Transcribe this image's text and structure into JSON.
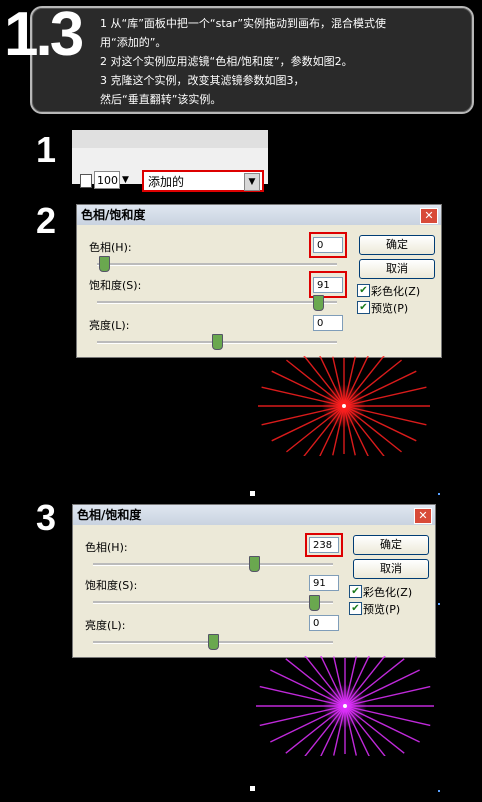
{
  "header": {
    "step": "1.3",
    "lines": [
      "1 从“库”面板中把一个“star”实例拖动到画布，混合模式使",
      "用“添加的”。",
      "2 对这个实例应用滤镜“色相/饱和度”，参数如图2。",
      "3 克隆这个实例，改变其滤镜参数如图3，",
      "然后“垂直翻转”该实例。"
    ]
  },
  "steps": {
    "one": "1",
    "two": "2",
    "three": "3"
  },
  "toolbar": {
    "opacity": "100",
    "blend_mode": "添加的"
  },
  "dialog2": {
    "title": "色相/饱和度",
    "hue_label": "色相(H):",
    "hue_value": "0",
    "sat_label": "饱和度(S):",
    "sat_value": "91",
    "bright_label": "亮度(L):",
    "bright_value": "0",
    "ok": "确定",
    "cancel": "取消",
    "colorize": "彩色化(Z)",
    "preview": "预览(P)"
  },
  "dialog3": {
    "title": "色相/饱和度",
    "hue_label": "色相(H):",
    "hue_value": "238",
    "sat_label": "饱和度(S):",
    "sat_value": "91",
    "bright_label": "亮度(L):",
    "bright_value": "0",
    "ok": "确定",
    "cancel": "取消",
    "colorize": "彩色化(Z)",
    "preview": "预览(P)"
  },
  "colors": {
    "star_red": "#ff2020",
    "star_magenta": "#e030ff",
    "highlight": "#dd0000"
  },
  "sliders": {
    "dialog2": {
      "hue": 0.03,
      "saturation": 0.92,
      "lightness": 0.5
    },
    "dialog3": {
      "hue": 0.67,
      "saturation": 0.92,
      "lightness": 0.5
    }
  }
}
